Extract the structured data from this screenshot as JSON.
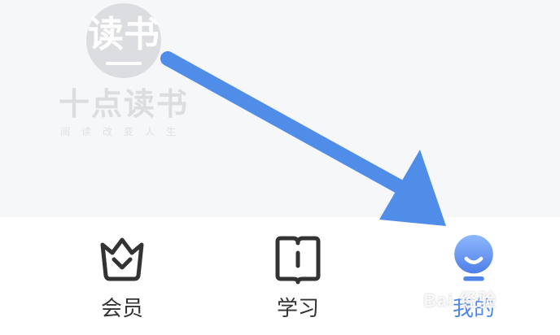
{
  "brand": {
    "badge_text": "读书",
    "title": "十点读书",
    "slogan": "阅读改变人生"
  },
  "tabbar": {
    "items": [
      {
        "label": "会员",
        "icon": "crown-icon",
        "active": false
      },
      {
        "label": "学习",
        "icon": "book-icon",
        "active": false
      },
      {
        "label": "我的",
        "icon": "profile-avatar-icon",
        "active": true
      }
    ]
  },
  "annotation": {
    "arrow_color": "#4f8de8",
    "points_to": "tab-mine"
  },
  "watermark": {
    "text": "Bai 经验"
  },
  "colors": {
    "accent": "#4f86e8",
    "label": "#333333",
    "background": "#f6f7f9"
  }
}
